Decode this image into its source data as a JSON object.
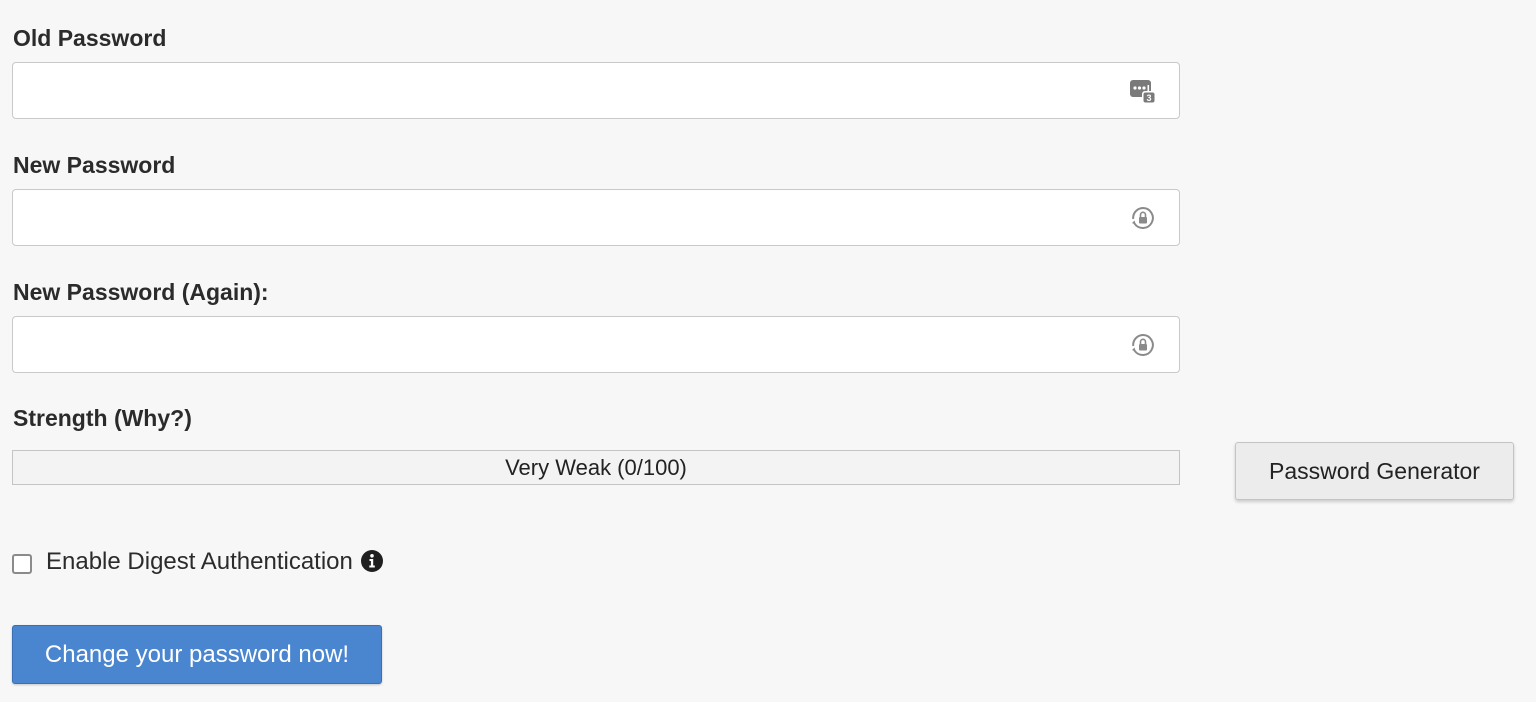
{
  "old_password": {
    "label": "Old Password",
    "value": "",
    "placeholder": "",
    "icon": "password-manager-icon",
    "icon_badge": "3"
  },
  "new_password": {
    "label": "New Password",
    "value": "",
    "placeholder": "",
    "icon": "autofill-lock-icon"
  },
  "new_password_again": {
    "label": "New Password (Again):",
    "value": "",
    "placeholder": "",
    "icon": "autofill-lock-icon"
  },
  "strength": {
    "label": "Strength (Why?)",
    "text": "Very Weak (0/100)",
    "score": 0,
    "max": 100
  },
  "generator_button": {
    "label": "Password Generator"
  },
  "digest_auth": {
    "label": "Enable Digest Authentication",
    "checked": false,
    "icon": "info-icon"
  },
  "submit_button": {
    "label": "Change your password now!"
  },
  "colors": {
    "background": "#f7f7f7",
    "primary_button": "#4a86cf",
    "icon_gray": "#8a8a8a",
    "strength_weak": "#d9534f"
  }
}
